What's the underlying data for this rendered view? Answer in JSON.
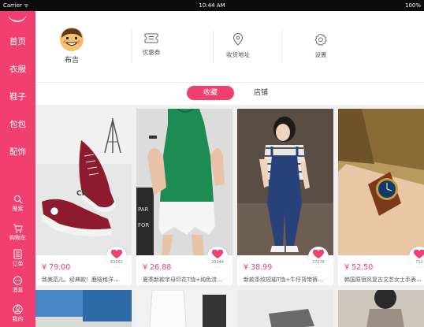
{
  "status": {
    "carrier": "Carrier ᯤ",
    "time": "10:44 AM",
    "battery": "100%"
  },
  "sidebar": {
    "categories": [
      "首页",
      "衣服",
      "鞋子",
      "包包",
      "配饰"
    ],
    "bottom_items": [
      {
        "label": "搜索",
        "icon": "search-icon"
      },
      {
        "label": "购物车",
        "icon": "cart-icon"
      },
      {
        "label": "订单",
        "icon": "order-icon"
      },
      {
        "label": "消息",
        "icon": "message-icon"
      },
      {
        "label": "我的",
        "icon": "profile-icon"
      }
    ],
    "color": "#f13f6f"
  },
  "header": {
    "username": "布吉",
    "items": [
      {
        "label": "优惠券",
        "icon": "coupon-icon"
      },
      {
        "label": "收货地址",
        "icon": "location-icon"
      },
      {
        "label": "设置",
        "icon": "settings-icon"
      }
    ]
  },
  "tabs": {
    "active": "收藏",
    "other": "店铺"
  },
  "products": [
    {
      "price": "¥ 79.00",
      "likes": "82052",
      "title": "致美范儿。经典款！鹿晗格洋..."
    },
    {
      "price": "¥ 26.88",
      "likes": "20244",
      "title": "夏季新款字母印花T恤+纯色流..."
    },
    {
      "price": "¥ 38.99",
      "likes": "27276",
      "title": "新款条纹短袖T恤+牛仔背带裤..."
    },
    {
      "price": "¥ 52.50",
      "likes": "713",
      "title": "韩国原宿风复古文艺女士手表..."
    }
  ]
}
